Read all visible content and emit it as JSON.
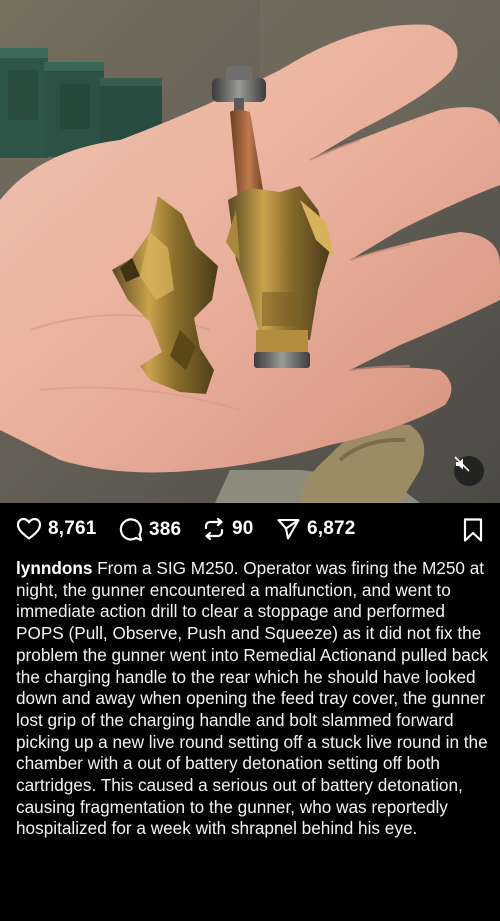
{
  "post": {
    "likes": "8,761",
    "comments": "386",
    "reposts": "90",
    "shares": "6,872",
    "username": "lynndons",
    "caption": "From a SIG M250. Operator was firing the M250 at night, the gunner encountered a malfunction, and went to immediate action drill to clear a stoppage and performed POPS (Pull, Observe, Push and Squeeze) as it did not fix the problem the gunner went into Remedial Actionand pulled back the charging handle to the rear which he should have looked down and away when opening the feed tray cover, the gunner lost grip of the charging handle and bolt slammed forward picking up a new live round setting off a stuck live round in the chamber with a out of battery detonation setting off both cartridges. This caused a serious out of battery detonation, causing fragmentation to the gunner, who was reportedly hospitalized for a week with shrapnel behind his eye."
  },
  "icons": {
    "like": "heart-icon",
    "comment": "comment-bubble-icon",
    "repost": "repost-arrows-icon",
    "share": "paper-plane-icon",
    "save": "bookmark-icon",
    "mute": "speaker-muted-icon"
  },
  "colors": {
    "background": "#000000",
    "text": "#ffffff"
  }
}
